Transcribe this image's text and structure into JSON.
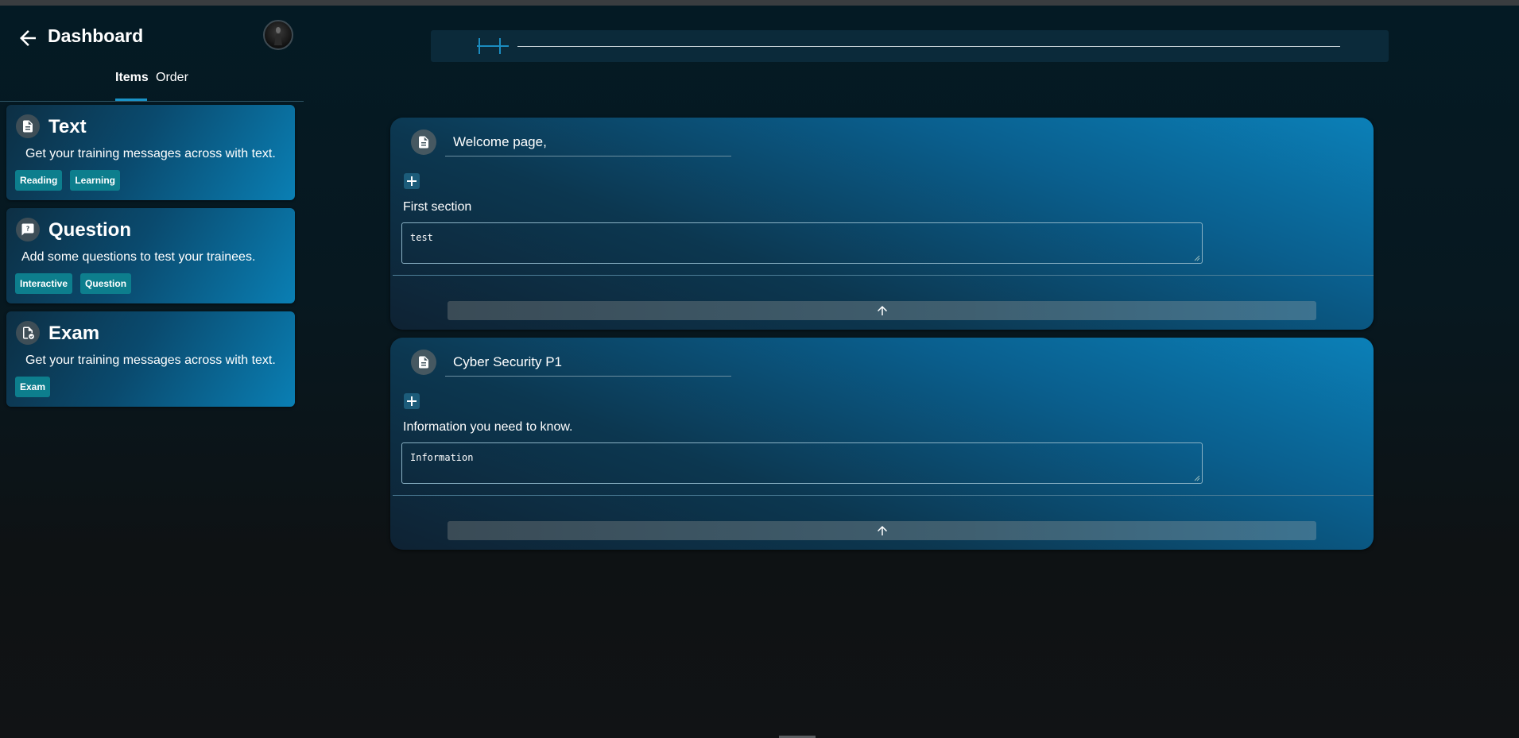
{
  "header": {
    "title": "Dashboard",
    "back_icon": "arrow-left-icon",
    "avatar_icon": "user-avatar"
  },
  "tabs": [
    {
      "label": "Items",
      "active": true
    },
    {
      "label": "Order",
      "active": false
    }
  ],
  "items": [
    {
      "icon": "document-icon",
      "title": "Text",
      "description": "Get your training messages across with text.",
      "tags": [
        "Reading",
        "Learning"
      ]
    },
    {
      "icon": "question-icon",
      "title": "Question",
      "description": "Add some questions to test your trainees.",
      "tags": [
        "Interactive",
        "Question"
      ]
    },
    {
      "icon": "exam-icon",
      "title": "Exam",
      "description": "Get your training messages across with text.",
      "tags": [
        "Exam"
      ]
    }
  ],
  "sections": [
    {
      "title": "Welcome page,",
      "label": "First section",
      "content": "test",
      "icon": "document-icon"
    },
    {
      "title": "Cyber Security P1",
      "label": "Information you need to know.",
      "content": "Information",
      "icon": "document-icon"
    }
  ],
  "colors": {
    "accent": "#1a93c7",
    "tag": "#0d7e8d",
    "card_end": "#0b80b8"
  }
}
